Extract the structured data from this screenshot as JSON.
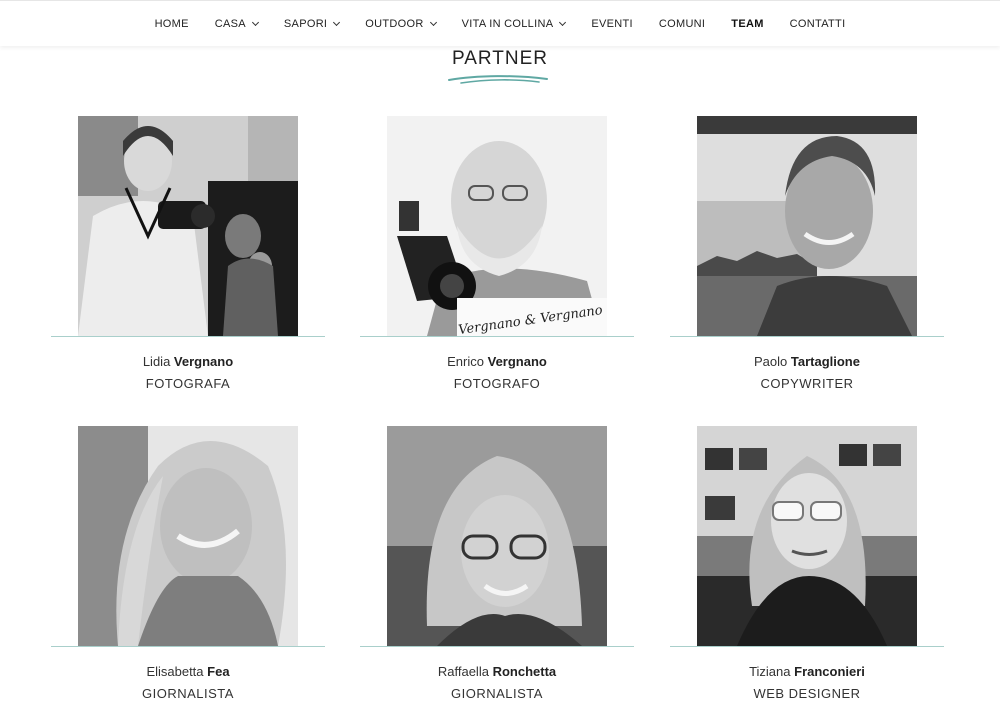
{
  "nav": {
    "items": [
      {
        "label": "HOME",
        "dropdown": false,
        "active": false
      },
      {
        "label": "CASA",
        "dropdown": true,
        "active": false
      },
      {
        "label": "SAPORI",
        "dropdown": true,
        "active": false
      },
      {
        "label": "OUTDOOR",
        "dropdown": true,
        "active": false
      },
      {
        "label": "VITA IN COLLINA",
        "dropdown": true,
        "active": false
      },
      {
        "label": "EVENTI",
        "dropdown": false,
        "active": false
      },
      {
        "label": "COMUNI",
        "dropdown": false,
        "active": false
      },
      {
        "label": "TEAM",
        "dropdown": false,
        "active": true
      },
      {
        "label": "CONTATTI",
        "dropdown": false,
        "active": false
      }
    ]
  },
  "section": {
    "title": "PARTNER"
  },
  "colors": {
    "accent": "#5fa8a3",
    "divider": "#a9cfcb"
  },
  "team": [
    {
      "first": "Lidia",
      "last": "Vergnano",
      "role": "FOTOGRAFA",
      "photo_text": ""
    },
    {
      "first": "Enrico",
      "last": "Vergnano",
      "role": "FOTOGRAFO",
      "photo_text": "Vergnano & Vergnano"
    },
    {
      "first": "Paolo",
      "last": "Tartaglione",
      "role": "COPYWRITER",
      "photo_text": ""
    },
    {
      "first": "Elisabetta",
      "last": "Fea",
      "role": "GIORNALISTA",
      "photo_text": ""
    },
    {
      "first": "Raffaella",
      "last": "Ronchetta",
      "role": "GIORNALISTA",
      "photo_text": ""
    },
    {
      "first": "Tiziana",
      "last": "Franconieri",
      "role": "WEB DESIGNER",
      "photo_text": ""
    }
  ]
}
